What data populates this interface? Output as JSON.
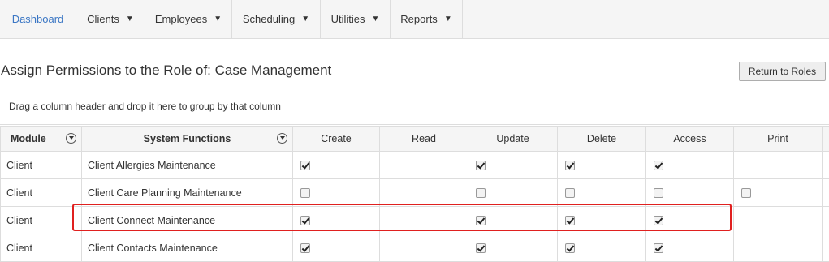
{
  "nav": {
    "items": [
      {
        "label": "Dashboard",
        "dropdown": false
      },
      {
        "label": "Clients",
        "dropdown": true
      },
      {
        "label": "Employees",
        "dropdown": true
      },
      {
        "label": "Scheduling",
        "dropdown": true
      },
      {
        "label": "Utilities",
        "dropdown": true
      },
      {
        "label": "Reports",
        "dropdown": true
      }
    ],
    "caret": "▼"
  },
  "page": {
    "title": "Assign Permissions to the Role of: Case Management",
    "return_button": "Return to Roles",
    "group_hint": "Drag a column header and drop it here to group by that column"
  },
  "table": {
    "columns": [
      "Module",
      "System Functions",
      "Create",
      "Read",
      "Update",
      "Delete",
      "Access",
      "Print"
    ],
    "rows": [
      {
        "module": "Client",
        "function": "Client Allergies Maintenance",
        "create": "checked",
        "read": "none",
        "update": "checked",
        "delete": "checked",
        "access": "checked",
        "print": "none"
      },
      {
        "module": "Client",
        "function": "Client Care Planning Maintenance",
        "create": "unchecked",
        "read": "none",
        "update": "unchecked",
        "delete": "unchecked",
        "access": "unchecked",
        "print": "unchecked"
      },
      {
        "module": "Client",
        "function": "Client Connect Maintenance",
        "create": "checked",
        "read": "none",
        "update": "checked",
        "delete": "checked",
        "access": "checked",
        "print": "none",
        "highlighted": true
      },
      {
        "module": "Client",
        "function": "Client Contacts Maintenance",
        "create": "checked",
        "read": "none",
        "update": "checked",
        "delete": "checked",
        "access": "checked",
        "print": "none"
      }
    ]
  },
  "colors": {
    "accent": "#3a76c4",
    "highlight": "#e0201f"
  }
}
